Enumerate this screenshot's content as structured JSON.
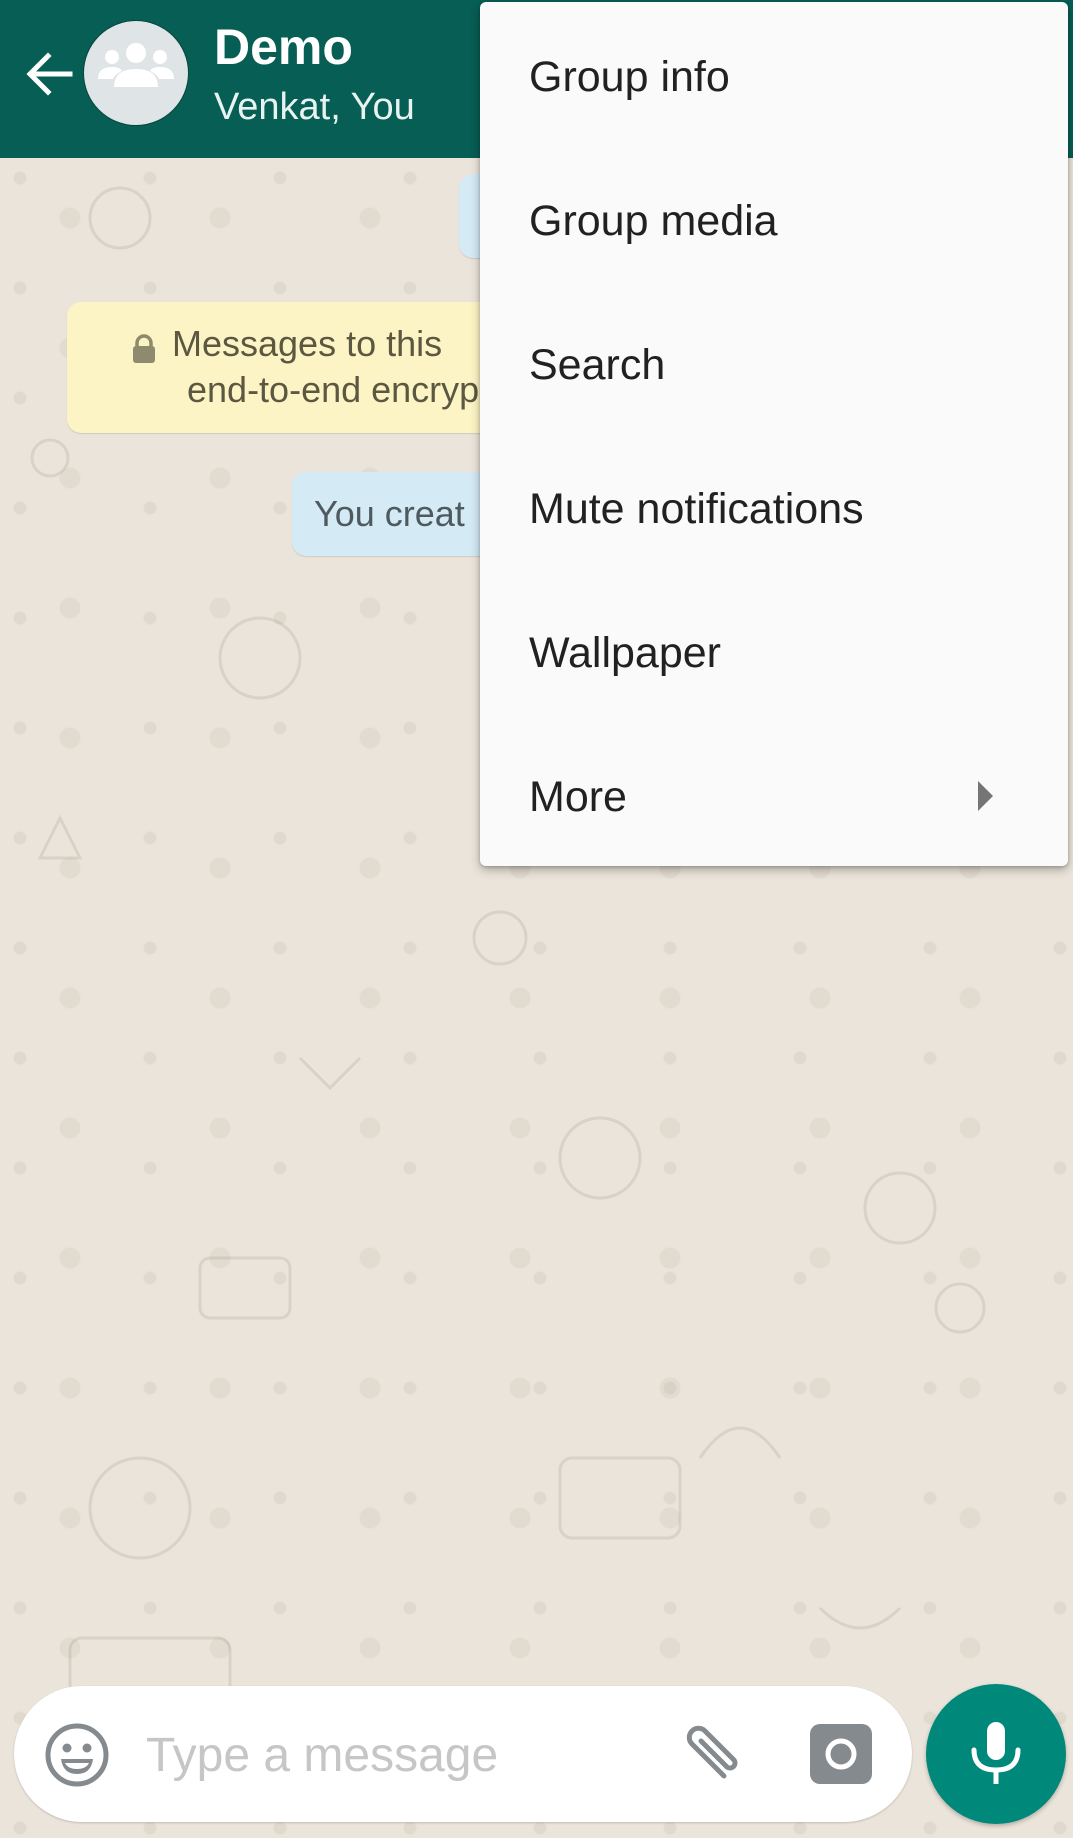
{
  "header": {
    "title": "Demo",
    "subtitle": "Venkat, You",
    "back_icon": "arrow-left-icon",
    "avatar_icon": "group-icon",
    "color": "#075e54"
  },
  "chat": {
    "encryption_notice": {
      "line1": "Messages to this",
      "line2": "end-to-end encryp",
      "icon": "lock-icon"
    },
    "system_message": "You creat"
  },
  "menu": {
    "items": [
      {
        "label": "Group info"
      },
      {
        "label": "Group media"
      },
      {
        "label": "Search"
      },
      {
        "label": "Mute notifications"
      },
      {
        "label": "Wallpaper"
      },
      {
        "label": "More",
        "has_submenu": true
      }
    ]
  },
  "composer": {
    "placeholder": "Type a message",
    "value": "",
    "emoji_icon": "emoji-icon",
    "attach_icon": "paperclip-icon",
    "camera_icon": "camera-icon",
    "mic_icon": "microphone-icon",
    "accent": "#00897b"
  }
}
